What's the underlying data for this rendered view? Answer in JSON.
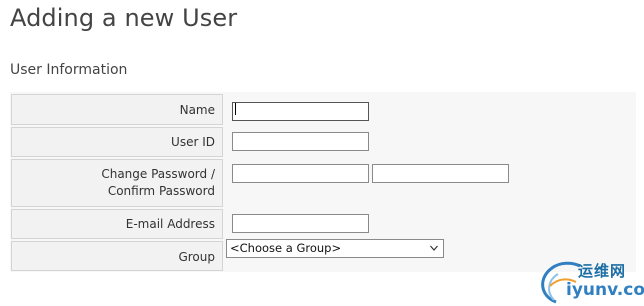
{
  "page": {
    "title": "Adding a new User"
  },
  "section": {
    "title": "User Information"
  },
  "form": {
    "name": {
      "label": "Name",
      "value": ""
    },
    "user_id": {
      "label": "User ID",
      "value": ""
    },
    "password": {
      "label": "Change Password / Confirm Password",
      "value": "",
      "confirm_value": ""
    },
    "email": {
      "label": "E-mail Address",
      "value": ""
    },
    "group": {
      "label": "Group",
      "selected": "<Choose a Group>"
    }
  },
  "watermark": {
    "text_cn": "运维网",
    "text_en": "iyunv.com"
  },
  "colors": {
    "panel_bg": "#f7f7f7",
    "label_bg": "#f2f2f2",
    "border": "#d4d4d4",
    "watermark_blue": "#2f7fc1"
  }
}
